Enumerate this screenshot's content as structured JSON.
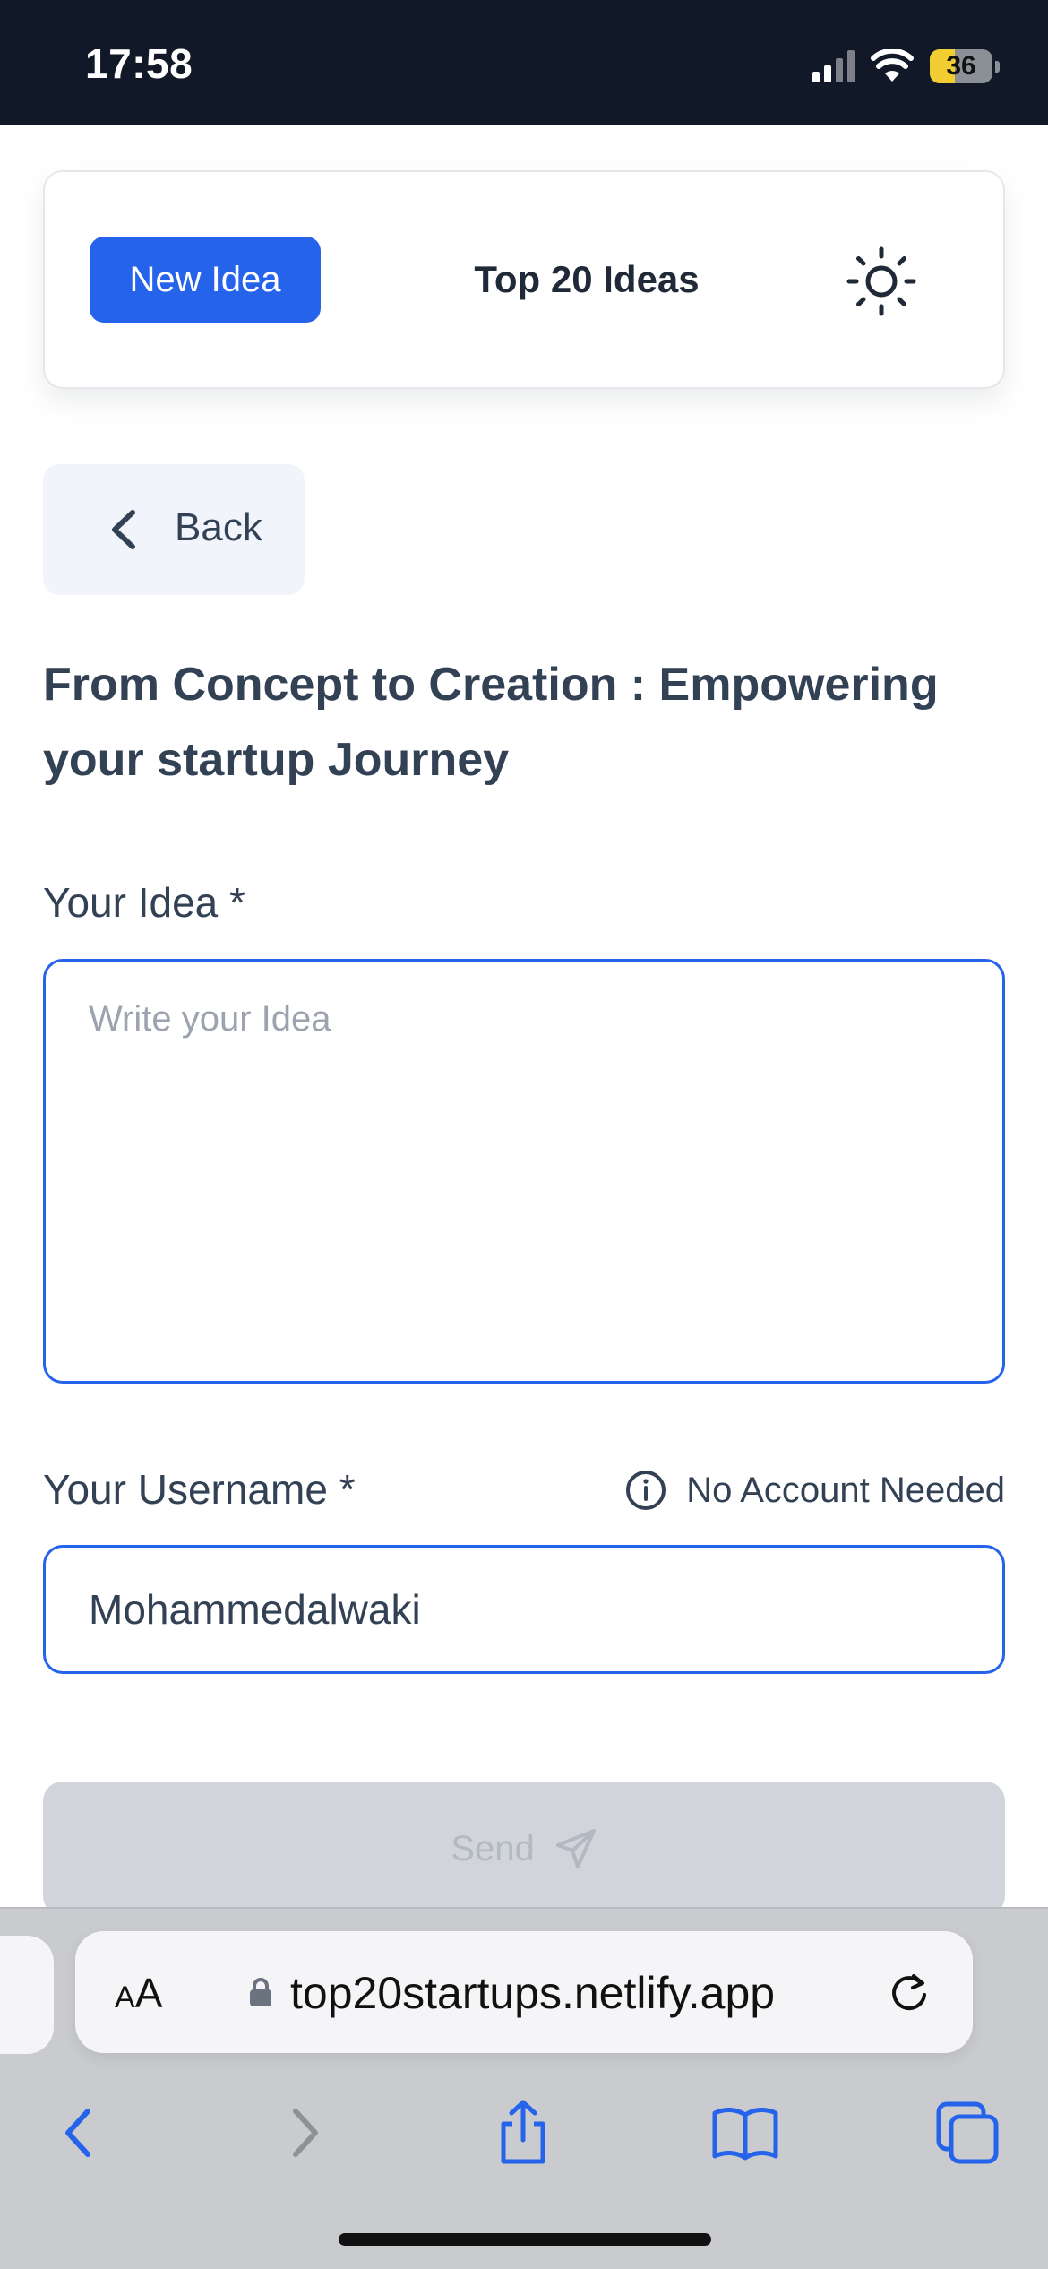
{
  "status": {
    "time": "17:58",
    "battery": "36"
  },
  "header": {
    "new_idea_label": "New Idea",
    "top_ideas_label": "Top 20 Ideas",
    "theme_icon": "sun-icon"
  },
  "back": {
    "label": "Back"
  },
  "page": {
    "title": "From Concept to Creation : Empowering your startup Journey"
  },
  "form": {
    "idea_label": "Your Idea *",
    "idea_placeholder": "Write your Idea",
    "idea_value": "",
    "username_label": "Your Username *",
    "no_account_note": "No Account Needed",
    "username_value": "Mohammedalwaki",
    "send_label": "Send"
  },
  "browser": {
    "aa_label_small": "A",
    "aa_label_large": "A",
    "url": "top20startups.netlify.app"
  },
  "colors": {
    "primary": "#2563eb",
    "status_bar_bg": "#111827",
    "disabled_button": "#d1d5db"
  }
}
